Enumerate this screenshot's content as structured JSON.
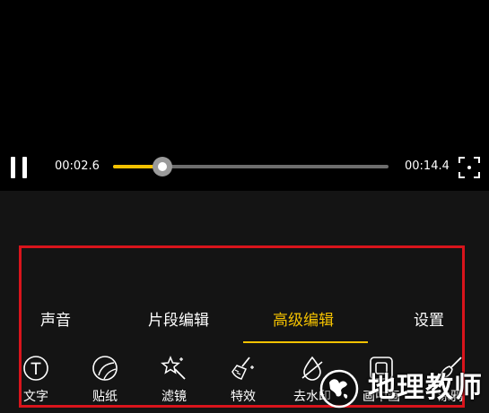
{
  "player": {
    "current_time": "00:02.6",
    "total_time": "00:14.4",
    "progress": 0.18,
    "accent_color": "#f5c200",
    "play_state_icon": "pause-icon",
    "fullscreen_icon": "fullscreen-icon"
  },
  "tabs": [
    {
      "label": "声音",
      "active": false
    },
    {
      "label": "片段编辑",
      "active": false
    },
    {
      "label": "高级编辑",
      "active": true
    },
    {
      "label": "设置",
      "active": false
    }
  ],
  "tools": [
    {
      "label": "文字",
      "icon": "text-icon"
    },
    {
      "label": "贴纸",
      "icon": "sticker-icon"
    },
    {
      "label": "滤镜",
      "icon": "filter-wand-icon"
    },
    {
      "label": "特效",
      "icon": "effects-broom-icon"
    },
    {
      "label": "去水印",
      "icon": "remove-watermark-icon"
    },
    {
      "label": "画中画",
      "icon": "picture-in-picture-icon"
    },
    {
      "label": "涂鸦",
      "icon": "brush-icon"
    }
  ],
  "highlight_color": "#d9141c",
  "watermark": {
    "text": "地理教师"
  }
}
